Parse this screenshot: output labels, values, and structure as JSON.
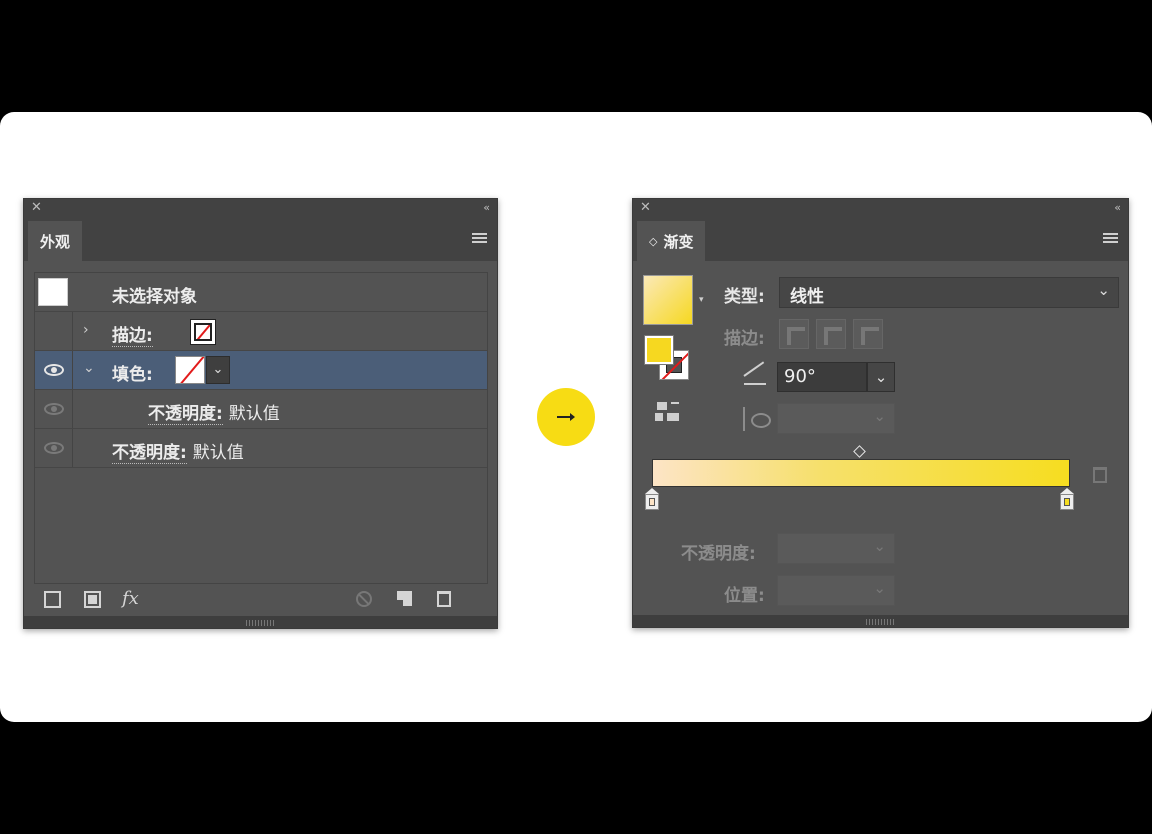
{
  "appearance_panel": {
    "close_glyph": "✕",
    "collapse_glyph": "‹‹",
    "tab_label": "外观",
    "rows": {
      "object": "未选择对象",
      "stroke_label": "描边:",
      "fill_label": "填色:",
      "sub_opacity_label": "不透明度:",
      "sub_opacity_value": "默认值",
      "opacity_label": "不透明度:",
      "opacity_value": "默认值"
    },
    "toolbar": {
      "fx_label": "fx"
    }
  },
  "gradient_panel": {
    "close_glyph": "✕",
    "collapse_glyph": "‹‹",
    "tab_label": "渐变",
    "tab_prefix": "◇",
    "type_label": "类型:",
    "type_value": "线性",
    "stroke_label": "描边:",
    "angle_value": "90°",
    "opacity_label": "不透明度:",
    "position_label": "位置:",
    "gradient_colors": [
      "#fde4c6",
      "#f6dd20"
    ]
  },
  "accent_color": "#f7dc14"
}
